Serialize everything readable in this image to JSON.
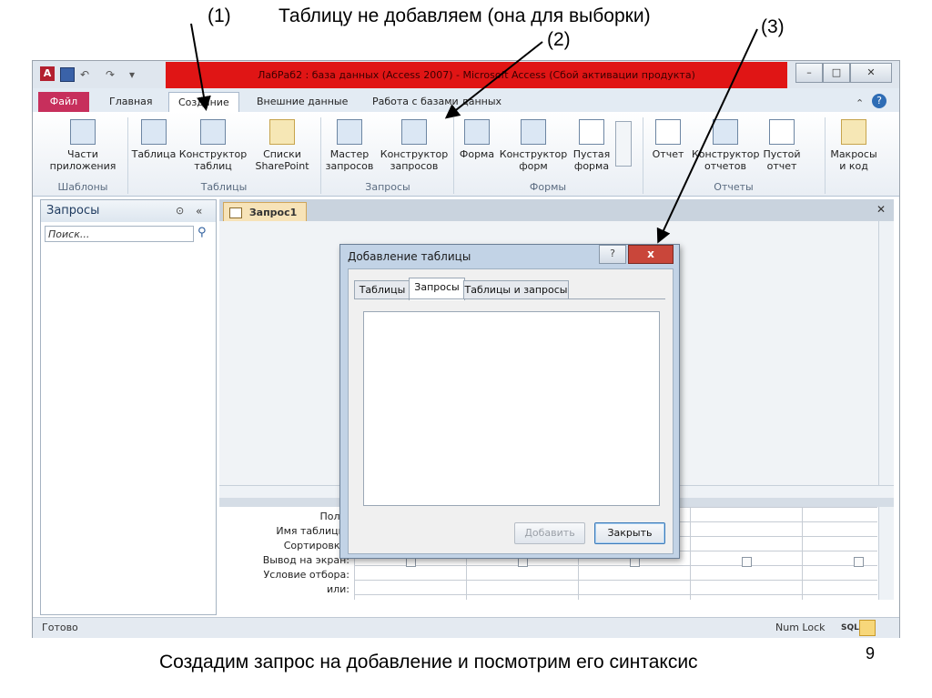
{
  "slide": {
    "annotation_1": "(1)",
    "annotation_2": "(2)",
    "annotation_3": "(3)",
    "top_note": "Таблицу не добавляем (она для выборки)",
    "caption": "Создадим запрос на добавление и посмотрим его синтаксис",
    "page_number": "9"
  },
  "window": {
    "title": "ЛабРаб2 : база данных (Access 2007) - Microsoft Access (Сбой активации продукта)",
    "qat_icons": [
      "access-icon",
      "save-icon",
      "undo-icon",
      "redo-icon"
    ]
  },
  "ribbon_tabs": [
    "Файл",
    "Главная",
    "Создание",
    "Внешние данные",
    "Работа с базами данных"
  ],
  "ribbon": {
    "groups": [
      "Шаблоны",
      "Таблицы",
      "Запросы",
      "Формы",
      "Отчеты"
    ],
    "buttons": {
      "app_parts": "Части приложения",
      "table": "Таблица",
      "table_designer": "Конструктор таблиц",
      "sharepoint_lists": "Списки SharePoint",
      "query_wizard": "Мастер запросов",
      "query_designer": "Конструктор запросов",
      "form": "Форма",
      "form_designer": "Конструктор форм",
      "blank_form": "Пустая форма",
      "report": "Отчет",
      "report_designer": "Конструктор отчетов",
      "blank_report": "Пустой отчет",
      "macros_code": "Макросы и код"
    }
  },
  "nav_pane": {
    "title": "Запросы",
    "search_placeholder": "Поиск..."
  },
  "document": {
    "tab": "Запрос1"
  },
  "qbe_grid": {
    "labels": [
      "Поле:",
      "Имя таблицы:",
      "Сортировка:",
      "Вывод на экран:",
      "Условие отбора:",
      "или:"
    ]
  },
  "status": {
    "left": "Готово",
    "num_lock": "Num Lock",
    "sql": "SQL"
  },
  "dialog": {
    "title": "Добавление таблицы",
    "help": "?",
    "close": "x",
    "tabs": [
      "Таблицы",
      "Запросы",
      "Таблицы и запросы"
    ],
    "active_tab": "Запросы",
    "add_button": "Добавить",
    "close_button": "Закрыть"
  }
}
